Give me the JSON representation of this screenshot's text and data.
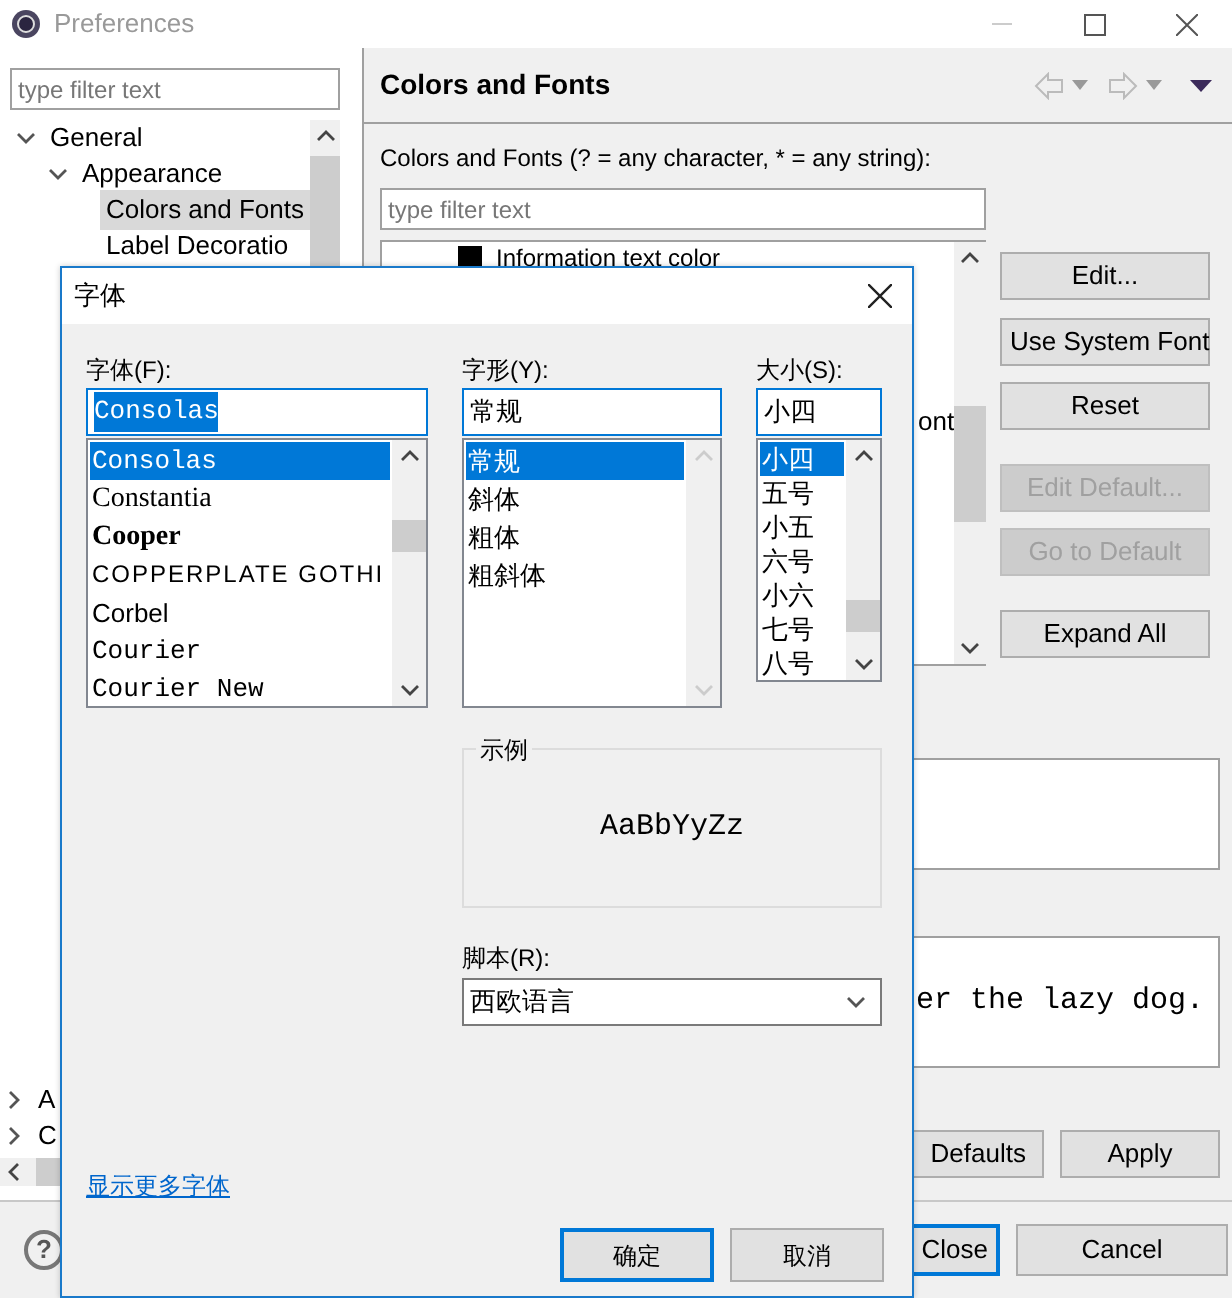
{
  "window": {
    "title": "Preferences",
    "help": "?"
  },
  "sidebar": {
    "filter_placeholder": "type filter text",
    "tree": [
      {
        "label": "General",
        "expanded": true,
        "selected": false,
        "children": [
          {
            "label": "Appearance",
            "expanded": true,
            "selected": false,
            "children": [
              {
                "label": "Colors and Fonts",
                "selected": true
              },
              {
                "label": "Label Decoratio",
                "selected": false
              }
            ]
          }
        ]
      },
      {
        "label": "A",
        "expanded": false,
        "selected": false
      },
      {
        "label": "C",
        "expanded": false,
        "selected": false
      }
    ]
  },
  "page": {
    "title": "Colors and Fonts",
    "description": "Colors and Fonts (? = any character, * = any string):",
    "filter_placeholder": "type filter text",
    "items": [
      {
        "label": "Information text color",
        "color": "#000000"
      },
      {
        "label": "ont"
      }
    ],
    "buttons": [
      {
        "label": "Edit...",
        "disabled": false
      },
      {
        "label": "Use System Font",
        "disabled": false
      },
      {
        "label": "Reset",
        "disabled": false
      },
      {
        "label": "Edit Default...",
        "disabled": true
      },
      {
        "label": "Go to Default",
        "disabled": true
      },
      {
        "label": "Expand All",
        "disabled": false
      }
    ],
    "preview_text": "er the lazy dog.",
    "footer_buttons": [
      {
        "label": "Defaults"
      },
      {
        "label": "Apply"
      }
    ]
  },
  "dialog_buttons": [
    {
      "label": "Close",
      "default": true
    },
    {
      "label": "Cancel",
      "default": false
    }
  ],
  "font_dialog": {
    "title": "字体",
    "fields": [
      {
        "label": "字体(F):",
        "value": "Consolas",
        "highlighted": true,
        "options": [
          {
            "label": "Consolas",
            "kind": "mono",
            "selected": true
          },
          {
            "label": "Constantia",
            "kind": "serif",
            "selected": false
          },
          {
            "label": "Cooper",
            "kind": "heavy",
            "selected": false
          },
          {
            "label": "COPPERPLATE GOTHI",
            "kind": "wide",
            "selected": false
          },
          {
            "label": "Corbel",
            "kind": "sans",
            "selected": false
          },
          {
            "label": "Courier",
            "kind": "mono",
            "selected": false
          },
          {
            "label": "Courier New",
            "kind": "mono",
            "selected": false
          }
        ]
      },
      {
        "label": "字形(Y):",
        "value": "常规",
        "highlighted": false,
        "options": [
          {
            "label": "常规",
            "kind": "sans",
            "selected": true
          },
          {
            "label": "斜体",
            "kind": "sans",
            "selected": false
          },
          {
            "label": "粗体",
            "kind": "sans",
            "selected": false
          },
          {
            "label": "粗斜体",
            "kind": "sans",
            "selected": false
          }
        ]
      },
      {
        "label": "大小(S):",
        "value": "小四",
        "highlighted": false,
        "options": [
          {
            "label": "小四",
            "kind": "sans",
            "selected": true
          },
          {
            "label": "五号",
            "kind": "sans",
            "selected": false
          },
          {
            "label": "小五",
            "kind": "sans",
            "selected": false
          },
          {
            "label": "六号",
            "kind": "sans",
            "selected": false
          },
          {
            "label": "小六",
            "kind": "sans",
            "selected": false
          },
          {
            "label": "七号",
            "kind": "sans",
            "selected": false
          },
          {
            "label": "八号",
            "kind": "sans",
            "selected": false
          }
        ]
      }
    ],
    "sample": {
      "label": "示例",
      "text": "AaBbYyZz"
    },
    "script": {
      "label": "脚本(R):",
      "value": "西欧语言"
    },
    "more_fonts_link": "显示更多字体",
    "buttons": [
      {
        "label": "确定",
        "default": true
      },
      {
        "label": "取消",
        "default": false
      }
    ]
  }
}
